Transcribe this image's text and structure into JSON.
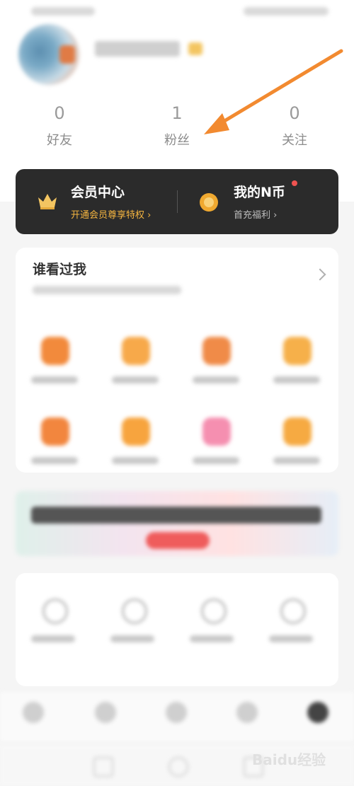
{
  "stats": [
    {
      "value": "0",
      "label": "好友"
    },
    {
      "value": "1",
      "label": "粉丝"
    },
    {
      "value": "0",
      "label": "关注"
    }
  ],
  "vip": {
    "title": "会员中心",
    "subtitle": "开通会员尊享特权",
    "coin_title": "我的N币",
    "coin_subtitle": "首充福利"
  },
  "visitors": {
    "title": "谁看过我"
  },
  "watermark": "Baidu经验",
  "colors": {
    "accent_orange": "#f28a30",
    "vip_bg": "#2b2b2b",
    "vip_gold": "#f5b540"
  }
}
